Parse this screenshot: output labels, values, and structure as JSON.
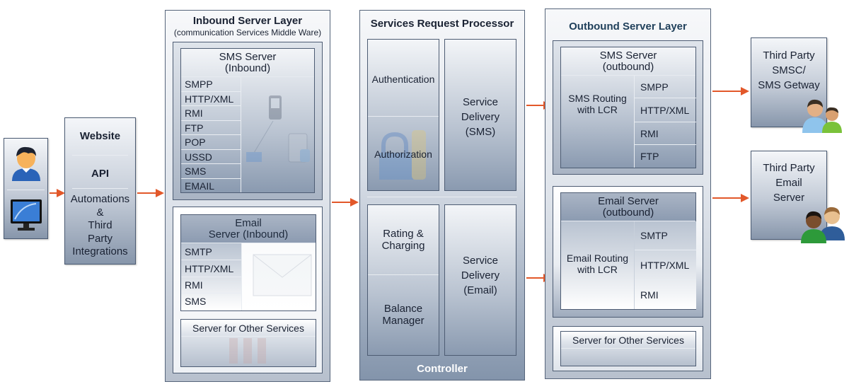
{
  "user_panel": {
    "icons": [
      "user-icon",
      "monitor-icon"
    ]
  },
  "website_panel": {
    "items": [
      "Website",
      "API",
      "Automations\n&\nThird\nParty\nIntegrations"
    ],
    "lines": [
      "Automations",
      "&",
      "Third",
      "Party",
      "Integrations"
    ]
  },
  "inbound": {
    "title": "Inbound Server Layer",
    "subtitle": "(communication Services Middle Ware)",
    "sms_server": {
      "title_line1": "SMS Server",
      "title_line2": "(Inbound)",
      "protocols": [
        "SMPP",
        "HTTP/XML",
        "RMI",
        "FTP",
        "POP",
        "USSD",
        "SMS",
        "EMAIL"
      ]
    },
    "email_server": {
      "title_line1": "Email",
      "title_line2": "Server (Inbound)",
      "protocols": [
        "SMTP",
        "HTTP/XML",
        "RMI",
        "SMS"
      ]
    },
    "other_services": "Server for Other Services"
  },
  "processor": {
    "title": "Services Request Processor",
    "authentication": "Authentication",
    "authorization": "Authorization",
    "service_delivery_sms": [
      "Service",
      "Delivery",
      "(SMS)"
    ],
    "rating_charging": [
      "Rating &",
      "Charging"
    ],
    "balance_manager": [
      "Balance",
      "Manager"
    ],
    "service_delivery_email": [
      "Service",
      "Delivery",
      "(Email)"
    ],
    "footer": "Controller"
  },
  "outbound": {
    "title": "Outbound Server Layer",
    "sms_server": {
      "title_line1": "SMS Server",
      "title_line2": "(outbound)",
      "routing": [
        "SMS Routing",
        "with LCR"
      ],
      "protocols": [
        "SMPP",
        "HTTP/XML",
        "RMI",
        "FTP"
      ]
    },
    "email_server": {
      "title_line1": "Email Server",
      "title_line2": "(outbound)",
      "routing": [
        "Email Routing",
        "with LCR"
      ],
      "protocols": [
        "SMTP",
        "HTTP/XML",
        "RMI"
      ]
    },
    "other_services": "Server for Other Services"
  },
  "third_party_sms": [
    "Third Party",
    "SMSC/",
    "SMS Getway"
  ],
  "third_party_email": [
    "Third Party",
    "Email",
    "Server"
  ],
  "colors": {
    "arrow": "#e2582a",
    "outbound_title": "#1f3f5a"
  }
}
